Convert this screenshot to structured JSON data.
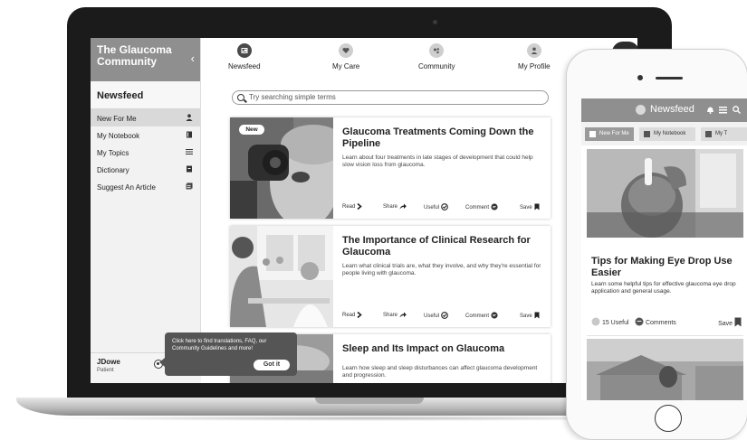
{
  "laptop": {
    "brand": "The Glaucoma Community",
    "sidebar": {
      "heading": "Newsfeed",
      "items": [
        {
          "label": "New For Me",
          "icon": "person-icon"
        },
        {
          "label": "My Notebook",
          "icon": "notebook-icon"
        },
        {
          "label": "My Topics",
          "icon": "list-icon"
        },
        {
          "label": "Dictionary",
          "icon": "dictionary-icon"
        },
        {
          "label": "Suggest An Article",
          "icon": "article-icon"
        }
      ],
      "user_name": "JDowe",
      "user_role": "Patient"
    },
    "nav": [
      {
        "label": "Newsfeed",
        "icon": "newspaper-icon"
      },
      {
        "label": "My Care",
        "icon": "heart-icon"
      },
      {
        "label": "Community",
        "icon": "people-icon"
      },
      {
        "label": "My Profile",
        "icon": "person-icon"
      }
    ],
    "search": {
      "placeholder": "Try searching simple terms"
    },
    "cards": [
      {
        "badge": "New",
        "title": "Glaucoma Treatments Coming Down the Pipeline",
        "desc": "Learn about four treatments in late stages of development that could help slow vision loss from glaucoma."
      },
      {
        "title": "The Importance of Clinical Research for Glaucoma",
        "desc": "Learn what clinical trials are, what they involve, and why they're essential for people living with glaucoma."
      },
      {
        "title": "Sleep and Its Impact on Glaucoma",
        "desc": "Learn how sleep and sleep disturbances can affect glaucoma development and progression."
      }
    ],
    "actions": {
      "read": "Read",
      "share": "Share",
      "useful": "Useful",
      "comment": "Comment",
      "save": "Save"
    },
    "tooltip": {
      "text": "Click here to find translations, FAQ, our Community Guidelines and more!",
      "button": "Got it"
    }
  },
  "phone": {
    "header_title": "Newsfeed",
    "tabs": [
      {
        "label": "New For Me"
      },
      {
        "label": "My Notebook"
      },
      {
        "label": "My T"
      }
    ],
    "article": {
      "title": "Tips for Making Eye Drop Use Easier",
      "desc": "Learn some helpful tips for effective glaucoma eye drop application and general usage.",
      "useful": "15 Useful",
      "comments": "Comments",
      "save": "Save"
    }
  },
  "colors": {
    "header_gray": "#8f8f8f",
    "sidebar_bg": "#f2f2f2",
    "active_item": "#d9d9d9",
    "tooltip_bg": "#555555"
  }
}
